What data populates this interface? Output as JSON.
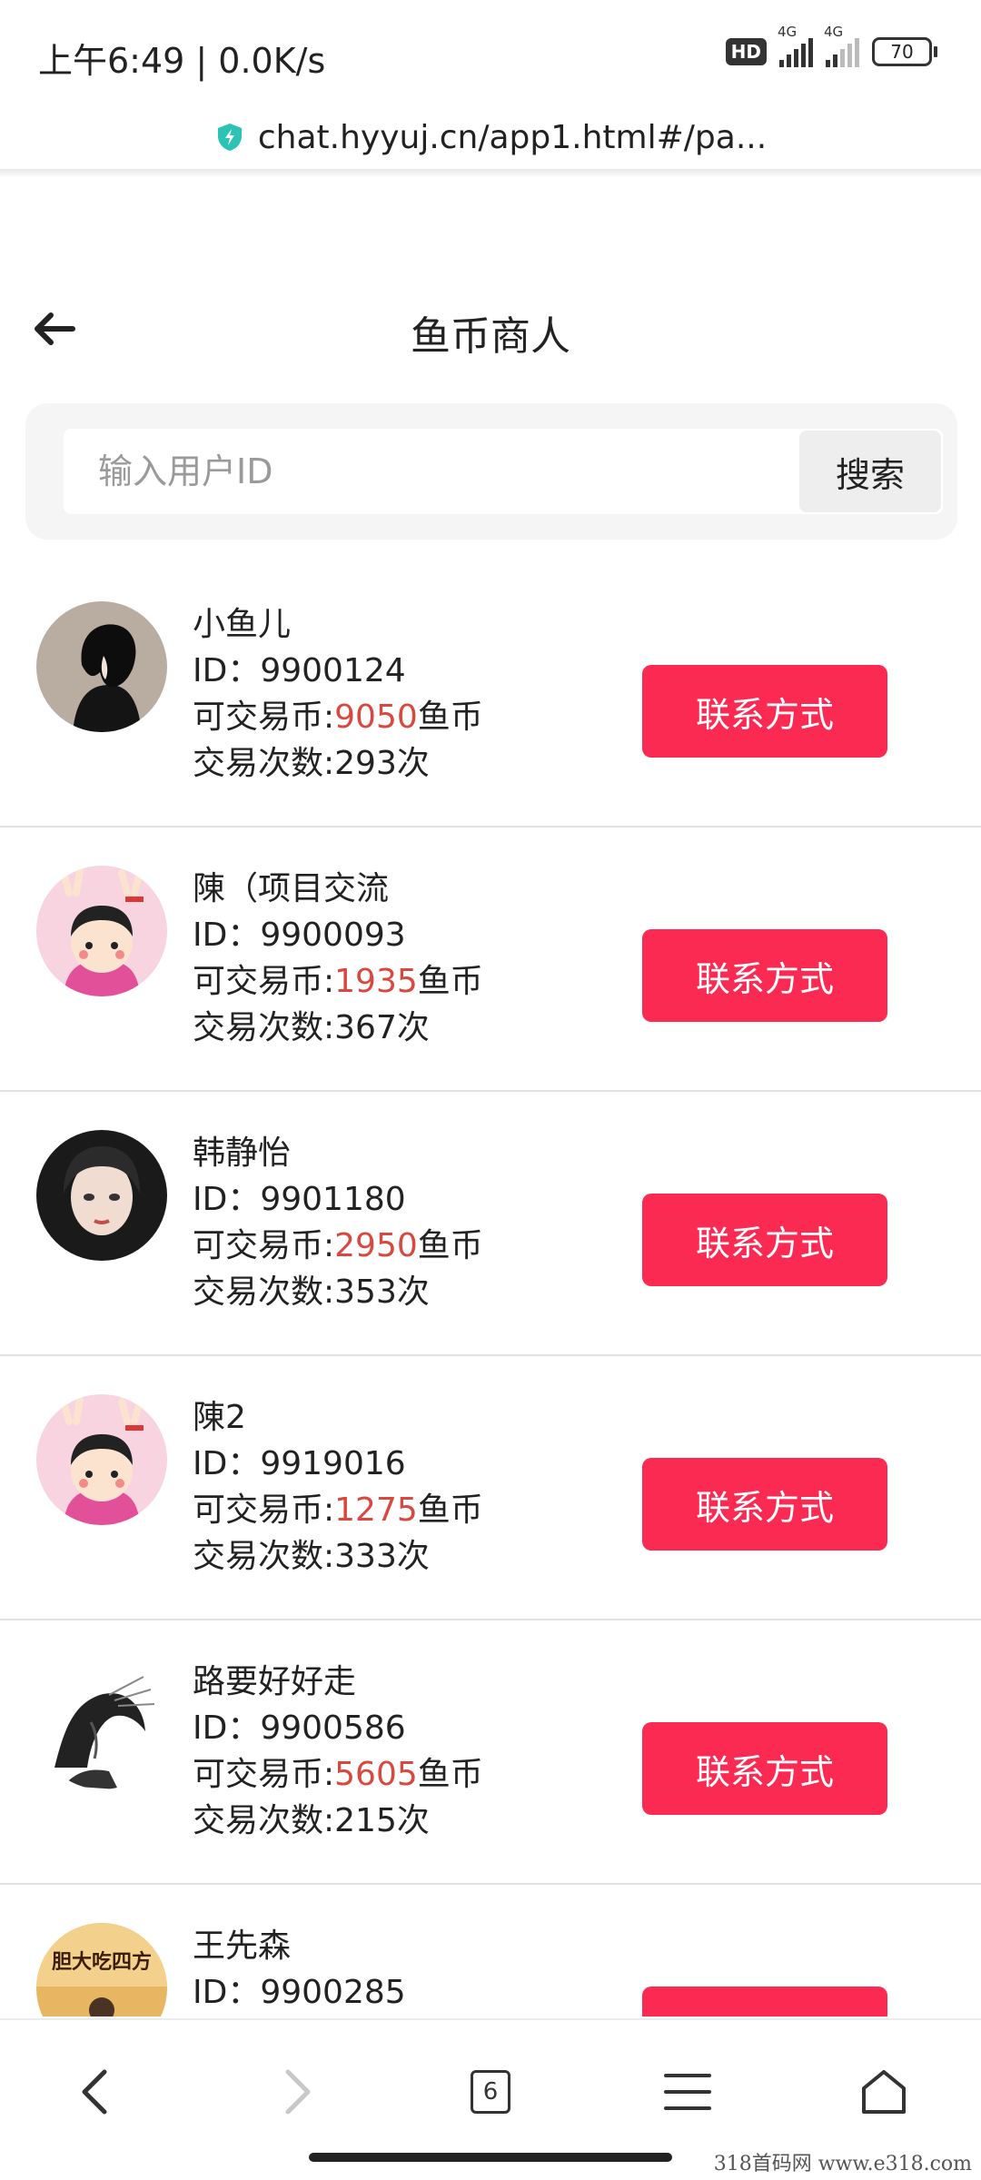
{
  "status": {
    "time": "上午6:49 | 0.0K/s",
    "hd": "HD",
    "net1": "4G",
    "net2": "4G",
    "battery": "70"
  },
  "browser": {
    "url": "chat.hyyuj.cn/app1.html#/pa...",
    "tab_count": "6"
  },
  "header": {
    "title": "鱼币商人"
  },
  "search": {
    "placeholder": "输入用户ID",
    "value": "",
    "button_label": "搜索"
  },
  "labels": {
    "coins_prefix": "可交易币:",
    "coins_suffix": "鱼币",
    "contact_button": "联系方式"
  },
  "merchants": [
    {
      "name": "小鱼儿",
      "id_line": "ID：9900124",
      "coins": "9050",
      "trades_line": "交易次数:293次"
    },
    {
      "name": "陳（项目交流",
      "id_line": "ID：9900093",
      "coins": "1935",
      "trades_line": "交易次数:367次"
    },
    {
      "name": "韩静怡",
      "id_line": "ID：9901180",
      "coins": "2950",
      "trades_line": "交易次数:353次"
    },
    {
      "name": "陳2",
      "id_line": "ID：9919016",
      "coins": "1275",
      "trades_line": "交易次数:333次"
    },
    {
      "name": "路要好好走",
      "id_line": "ID：9900586",
      "coins": "5605",
      "trades_line": "交易次数:215次"
    },
    {
      "name": "王先森",
      "id_line": "ID：9900285",
      "coins": "",
      "trades_line": ""
    }
  ],
  "avatar_text": "胆大吃四方",
  "watermark": "318首码网  www.e318.com",
  "colors": {
    "accent": "#fb2a52",
    "coin_value": "#d9473f"
  }
}
